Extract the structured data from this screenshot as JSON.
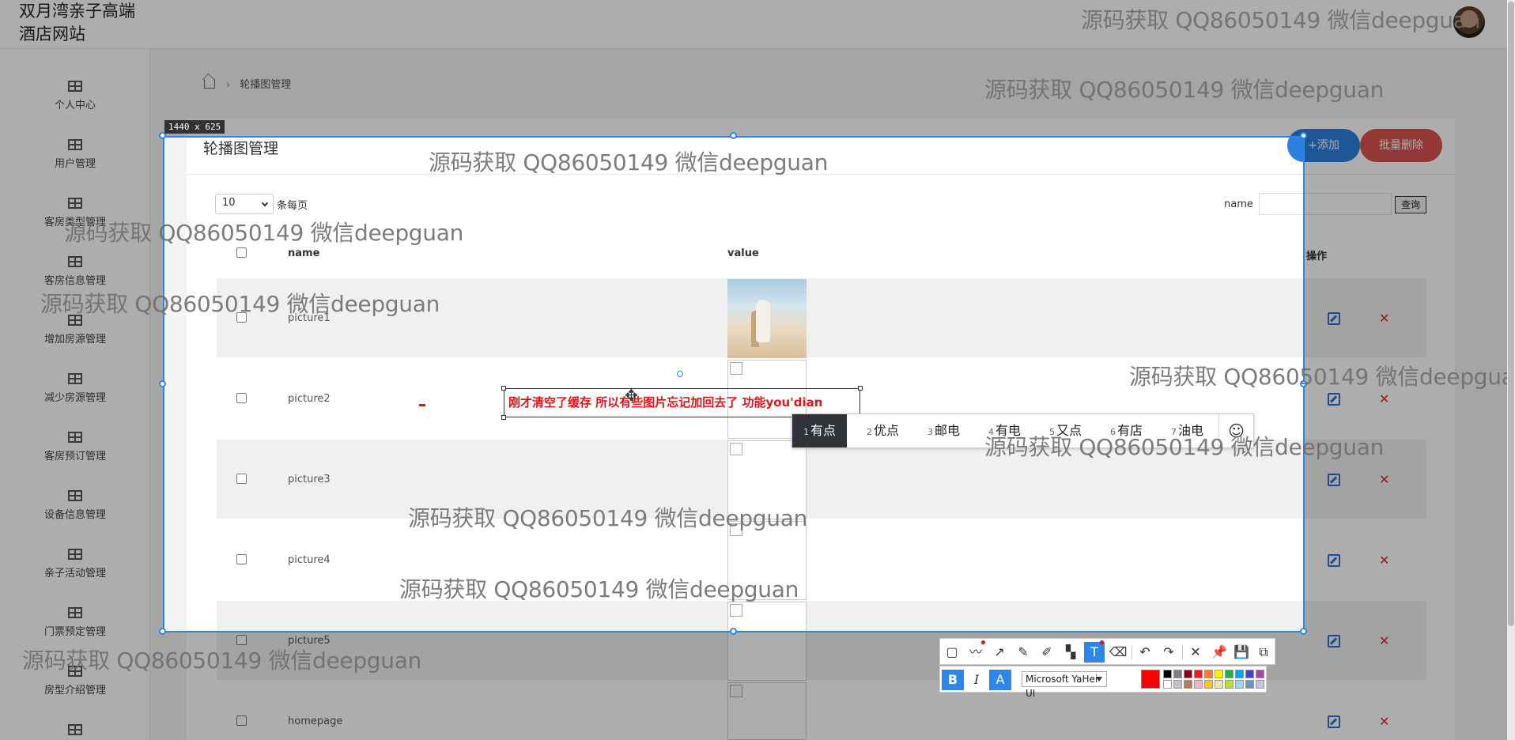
{
  "header": {
    "site_title": "双月湾亲子高端酒店网站"
  },
  "sidebar": {
    "items": [
      {
        "label": "个人中心"
      },
      {
        "label": "用户管理"
      },
      {
        "label": "客房类型管理"
      },
      {
        "label": "客房信息管理"
      },
      {
        "label": "增加房源管理"
      },
      {
        "label": "减少房源管理"
      },
      {
        "label": "客房预订管理"
      },
      {
        "label": "设备信息管理"
      },
      {
        "label": "亲子活动管理"
      },
      {
        "label": "门票预定管理"
      },
      {
        "label": "房型介绍管理"
      },
      {
        "label": ""
      }
    ]
  },
  "breadcrumb": {
    "current": "轮播图管理"
  },
  "page": {
    "title": "轮播图管理",
    "add_button": "+添加",
    "batch_delete_button": "批量删除",
    "page_size": "10",
    "per_page_label": "条每页",
    "search_label": "name",
    "search_value": "",
    "search_button": "查询"
  },
  "table": {
    "headers": {
      "name": "name",
      "value": "value",
      "actions": "操作"
    },
    "rows": [
      {
        "name": "picture1",
        "has_image": true
      },
      {
        "name": "picture2",
        "has_image": false
      },
      {
        "name": "picture3",
        "has_image": false
      },
      {
        "name": "picture4",
        "has_image": false
      },
      {
        "name": "picture5",
        "has_image": false
      },
      {
        "name": "homepage",
        "has_image": false
      }
    ]
  },
  "screenshot_tool": {
    "size_label": "1440 x 625",
    "annotation_text": "刚才清空了缓存 所以有些图片忘记加回去了 功能you'dian",
    "font_name": "Microsoft YaHei UI",
    "current_color": "#ff0000",
    "palette": [
      "#000000",
      "#7f7f7f",
      "#880015",
      "#ed1c24",
      "#ff7f27",
      "#fff200",
      "#22b14c",
      "#00a2e8",
      "#3f48cc",
      "#a349a4",
      "#ffffff",
      "#c3c3c3",
      "#b97a57",
      "#ffaec9",
      "#ffc90e",
      "#efe4b0",
      "#b5e61d",
      "#99d9ea",
      "#7092be",
      "#c8bfe7"
    ],
    "tools": [
      "rectangle-icon",
      "polyline-icon",
      "arrow-icon",
      "pencil-icon",
      "marker-icon",
      "mosaic-icon",
      "text-icon",
      "eraser-icon",
      "undo-icon",
      "redo-icon",
      "close-icon",
      "pin-icon",
      "save-icon",
      "copy-icon"
    ]
  },
  "ime": {
    "candidates": [
      {
        "n": "1",
        "text": "有点"
      },
      {
        "n": "2",
        "text": "优点"
      },
      {
        "n": "3",
        "text": "邮电"
      },
      {
        "n": "4",
        "text": "有电"
      },
      {
        "n": "5",
        "text": "又点"
      },
      {
        "n": "6",
        "text": "有店"
      },
      {
        "n": "7",
        "text": "油电"
      }
    ],
    "emoji": "☺"
  },
  "watermark": "源码获取 QQ86050149 微信deepguan"
}
